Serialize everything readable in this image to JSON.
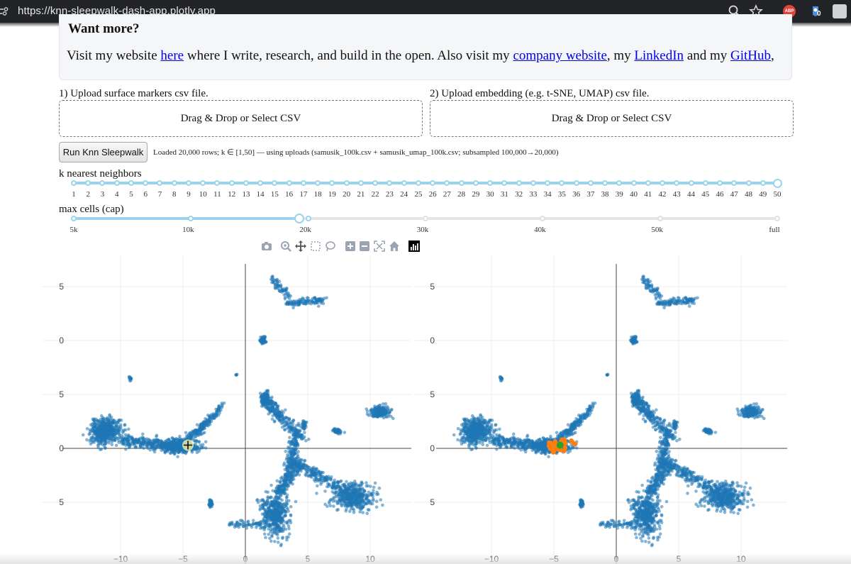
{
  "browser": {
    "url": "https://knn-sleepwalk-dash-app.plotly.app",
    "extension_badge": "ABP",
    "extension_count": "0"
  },
  "info": {
    "heading": "Want more?",
    "text_1": "Visit my website ",
    "link_1": "here",
    "text_2": " where I write, research, and build in the open. Also visit my ",
    "link_2": "company website",
    "text_3": ", my ",
    "link_3": "LinkedIn",
    "text_4": " and my ",
    "link_4": "GitHub",
    "text_5": ","
  },
  "uploads": [
    {
      "label": "1) Upload surface markers csv file.",
      "dropzone": "Drag & Drop or Select CSV"
    },
    {
      "label": "2) Upload embedding (e.g. t-SNE, UMAP) csv file.",
      "dropzone": "Drag & Drop or Select CSV"
    }
  ],
  "run_button": "Run Knn Sleepwalk",
  "status": "Loaded 20,000 rows; k ∈ [1,50] — using uploads (samusik_100k.csv + samusik_umap_100k.csv; subsampled 100,000→20,000)",
  "k_slider": {
    "title": "k nearest neighbors",
    "min": 1,
    "max": 50,
    "value": 50,
    "marks": [
      "1",
      "2",
      "3",
      "4",
      "5",
      "6",
      "7",
      "8",
      "9",
      "10",
      "11",
      "12",
      "13",
      "14",
      "15",
      "16",
      "17",
      "18",
      "19",
      "20",
      "21",
      "22",
      "23",
      "24",
      "25",
      "26",
      "27",
      "28",
      "29",
      "30",
      "31",
      "32",
      "33",
      "34",
      "35",
      "36",
      "37",
      "38",
      "39",
      "40",
      "41",
      "42",
      "43",
      "44",
      "45",
      "46",
      "47",
      "48",
      "49",
      "50"
    ]
  },
  "cap_slider": {
    "title": "max cells (cap)",
    "marks": [
      "5k",
      "10k",
      "20k",
      "30k",
      "40k",
      "50k",
      "full"
    ],
    "value_index": 2
  },
  "modebar": [
    "camera-icon",
    "zoom-icon",
    "pan-icon",
    "box-select-icon",
    "lasso-icon",
    "zoom-in-icon",
    "zoom-out-icon",
    "autoscale-icon",
    "reset-axes-icon",
    "plotly-logo-icon"
  ],
  "plot_axes": {
    "x_ticks": [
      "−10",
      "−5",
      "0",
      "5",
      "10"
    ],
    "y_ticks": [
      "5",
      "0",
      "5",
      "0",
      "5"
    ]
  },
  "colors": {
    "points": "#1f77b4",
    "neighbors": "#ff7f0e",
    "selected": "#2ca02c",
    "slider": "#9cd3ec",
    "link": "#0000ee"
  }
}
